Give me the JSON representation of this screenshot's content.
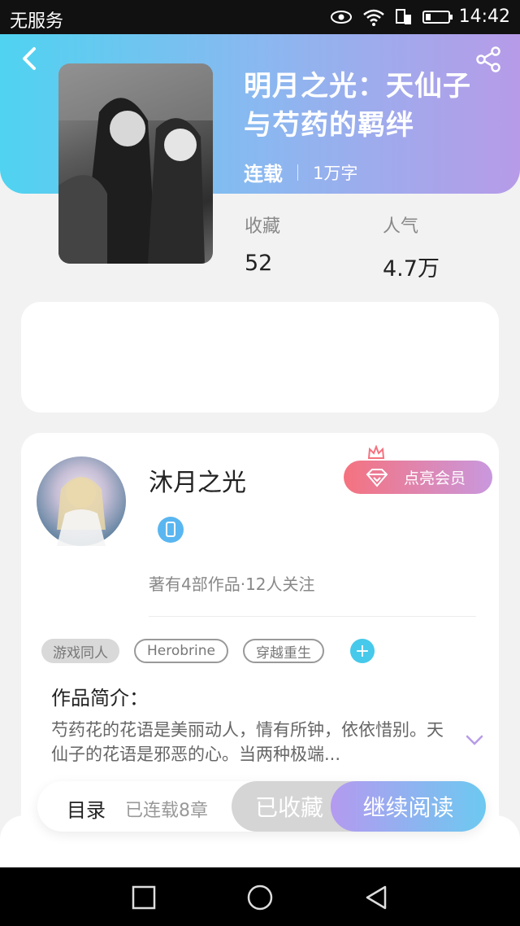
{
  "statusbar": {
    "carrier": "无服务",
    "time": "14:42"
  },
  "book": {
    "title": "明月之光：天仙子与芍药的羁绊",
    "status": "连载",
    "word_count": "1万字",
    "stats": [
      {
        "label": "收藏",
        "value": "52"
      },
      {
        "label": "人气",
        "value": "4.7万"
      }
    ]
  },
  "author": {
    "name": "沐月之光",
    "stats": "著有4部作品·12人关注",
    "vip_label": "点亮会员"
  },
  "tags": [
    "游戏同人",
    "Herobrine",
    "穿越重生"
  ],
  "intro": {
    "heading": "作品简介：",
    "text": "芍药花的花语是美丽动人，情有所钟，依依惜别。天仙子的花语是邪恶的心。当两种极端..."
  },
  "actionbar": {
    "toc_label": "目录",
    "chapters_label": "已连载8章",
    "favorite_label": "已收藏",
    "read_label": "继续阅读"
  },
  "colors": {
    "header_start": "#4fd3f0",
    "header_end": "#b79be8",
    "accent_blue": "#46c9ea",
    "vip_pink": "#f5727f"
  },
  "icons": [
    "back-icon",
    "share-icon",
    "eye-icon",
    "wifi-icon",
    "sim-icon",
    "battery-icon",
    "diamond-icon",
    "crown-icon",
    "phone-badge-icon",
    "chevron-down-icon",
    "plus-icon",
    "square-nav-icon",
    "circle-nav-icon",
    "triangle-nav-icon"
  ]
}
